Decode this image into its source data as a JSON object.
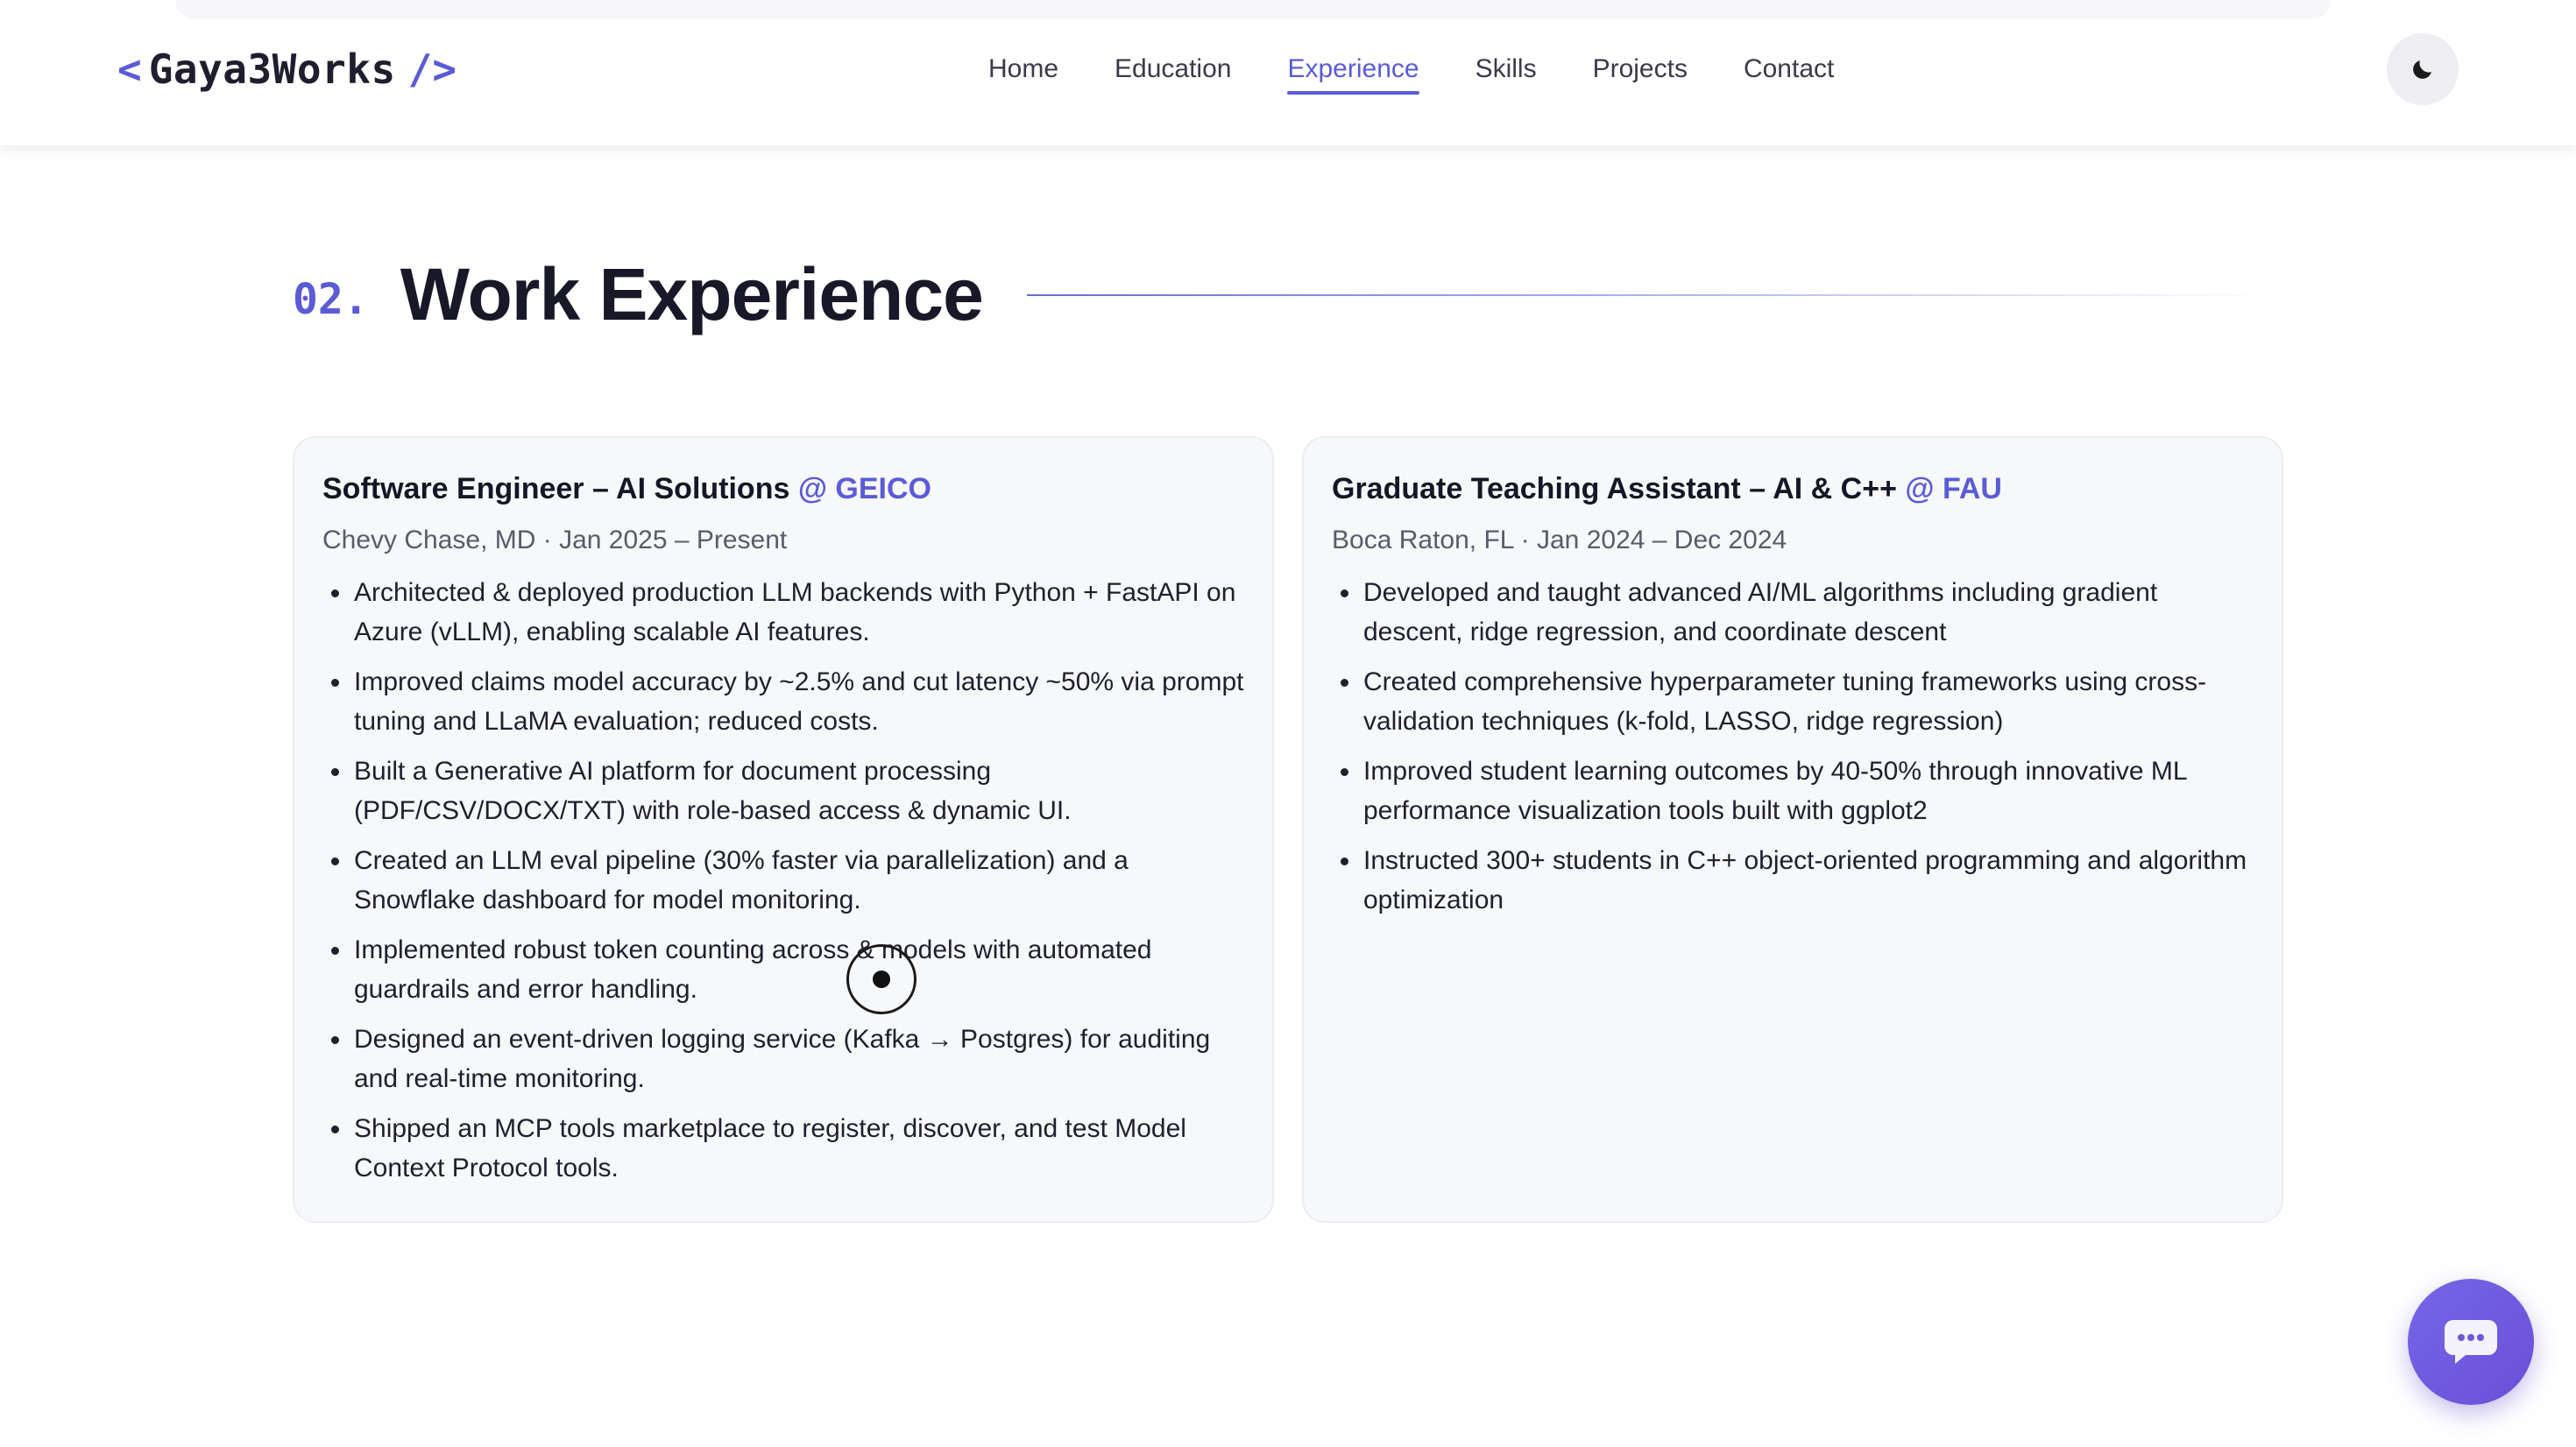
{
  "logo": {
    "open_bracket": "<",
    "text": "Gaya3Works",
    "close_bracket": "/>"
  },
  "nav": {
    "items": [
      {
        "label": "Home",
        "active": false
      },
      {
        "label": "Education",
        "active": false
      },
      {
        "label": "Experience",
        "active": true
      },
      {
        "label": "Skills",
        "active": false
      },
      {
        "label": "Projects",
        "active": false
      },
      {
        "label": "Contact",
        "active": false
      }
    ],
    "theme_toggle_icon": "moon-icon"
  },
  "section": {
    "number": "02.",
    "title": "Work Experience"
  },
  "experience": [
    {
      "role": "Software Engineer – AI Solutions",
      "company": "@ GEICO",
      "meta": "Chevy Chase, MD · Jan 2025 – Present",
      "bullets": [
        "Architected & deployed production LLM backends with Python + FastAPI on Azure (vLLM), enabling scalable AI features.",
        "Improved claims model accuracy by ~2.5% and cut latency ~50% via prompt tuning and LLaMA evaluation; reduced costs.",
        "Built a Generative AI platform for document processing (PDF/CSV/DOCX/TXT) with role-based access & dynamic UI.",
        "Created an LLM eval pipeline (30% faster via parallelization) and a Snowflake dashboard for model monitoring.",
        "Implemented robust token counting across & models with automated guardrails and error handling.",
        "Designed an event-driven logging service (Kafka → Postgres) for auditing and real-time monitoring.",
        "Shipped an MCP tools marketplace to register, discover, and test Model Context Protocol tools."
      ]
    },
    {
      "role": "Graduate Teaching Assistant – AI & C++",
      "company": "@ FAU",
      "meta": "Boca Raton, FL · Jan 2024 – Dec 2024",
      "bullets": [
        "Developed and taught advanced AI/ML algorithms including gradient descent, ridge regression, and coordinate descent",
        "Created comprehensive hyperparameter tuning frameworks using cross-validation techniques (k-fold, LASSO, ridge regression)",
        "Improved student learning outcomes by 40-50% through innovative ML performance visualization tools built with ggplot2",
        "Instructed 300+ students in C++ object-oriented programming and algorithm optimization"
      ]
    }
  ],
  "chat": {
    "icon": "chat-bubble-icon"
  },
  "colors": {
    "accent": "#5b5bd6",
    "heading": "#181828",
    "card_bg": "#f7f8fa",
    "chat_bg": "#7566e8"
  }
}
